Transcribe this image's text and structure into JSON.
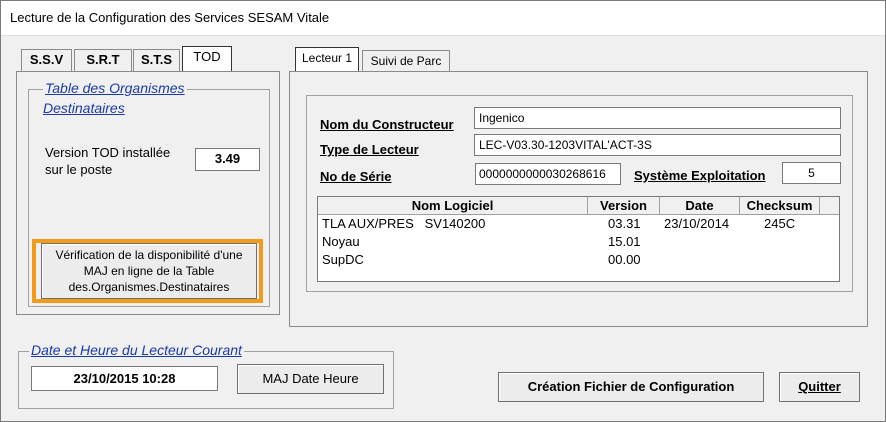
{
  "window": {
    "title": "Lecture de la Configuration des Services SESAM Vitale"
  },
  "left_tabs": [
    "S.S.V",
    "S.R.T",
    "S.T.S",
    "TOD"
  ],
  "tod": {
    "group_title_line1": "Table des Organismes",
    "group_title_line2": "Destinataires",
    "version_label_line1": "Version TOD installée",
    "version_label_line2": "sur le poste",
    "version_value": "3.49",
    "check_button_line1": "Vérification de la disponibilité d'une",
    "check_button_line2": "MAJ en ligne  de la Table",
    "check_button_line3": "des.Organismes.Destinataires"
  },
  "right_tabs": [
    "Lecteur 1",
    "Suivi de Parc"
  ],
  "reader": {
    "constructor_label": "Nom du Constructeur",
    "constructor_value": "Ingenico",
    "type_label": "Type de Lecteur",
    "type_value": "LEC-V03.30-1203VITAL'ACT-3S",
    "serial_label": "No de Série",
    "serial_value": "0000000000030268616",
    "os_label": "Système Exploitation",
    "os_value": "5"
  },
  "software_table": {
    "columns": [
      "Nom Logiciel",
      "Version",
      "Date",
      "Checksum"
    ],
    "rows": [
      {
        "name": "TLA AUX/PRES   SV140200",
        "version": "03.31",
        "date": "23/10/2014",
        "checksum": "245C"
      },
      {
        "name": "Noyau",
        "version": "15.01",
        "date": "",
        "checksum": ""
      },
      {
        "name": "SupDC",
        "version": "00.00",
        "date": "",
        "checksum": ""
      }
    ]
  },
  "datetime": {
    "group_title": "Date et  Heure du Lecteur Courant",
    "value": "23/10/2015 10:28",
    "update_button": "MAJ Date Heure"
  },
  "actions": {
    "create_config": "Création Fichier de Configuration",
    "quit": "Quitter"
  },
  "colors": {
    "highlight": "#f29a1a",
    "group_title": "#1a3aa8"
  }
}
